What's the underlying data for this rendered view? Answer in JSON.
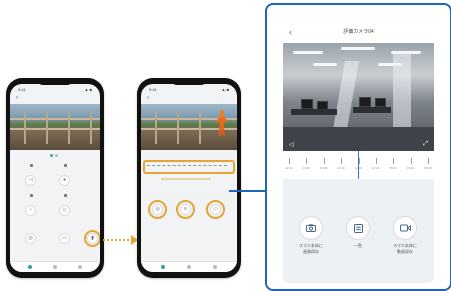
{
  "status_bar": {
    "time": "9:41",
    "icons": "▲ ■"
  },
  "phones": [
    {
      "title": "",
      "tab_count": 3
    },
    {
      "title": "",
      "tab_count": 3
    }
  ],
  "highlight_labels": {
    "phone1_button": "",
    "phone2_buttons": [
      "",
      "",
      ""
    ]
  },
  "zoom": {
    "title": "評価カメラ04",
    "back": "‹",
    "timeline_labels": [
      "12:00",
      "12:30",
      "13:00",
      "13:30",
      "14:00",
      "14:30",
      "15:00",
      "15:30",
      "16:00"
    ],
    "actions": [
      {
        "icon": "camera-icon",
        "label_line1": "スマホ本体に",
        "label_line2": "画像保存"
      },
      {
        "icon": "list-icon",
        "label_line1": "一覧",
        "label_line2": ""
      },
      {
        "icon": "video-icon",
        "label_line1": "スマホ本体に",
        "label_line2": "動画保存"
      }
    ]
  },
  "colors": {
    "accent": "#e4a436",
    "frame": "#1f67b4",
    "person": "#f07a22"
  }
}
